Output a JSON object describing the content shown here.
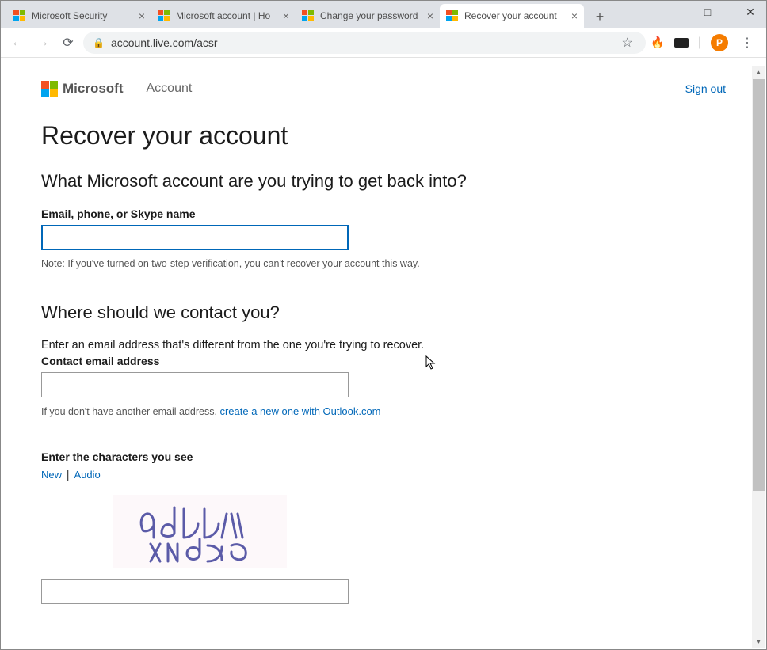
{
  "window_controls": {
    "min": "—",
    "max": "□",
    "close": "✕"
  },
  "tabs": [
    {
      "title": "Microsoft Security"
    },
    {
      "title": "Microsoft account | Ho"
    },
    {
      "title": "Change your password"
    },
    {
      "title": "Recover your account"
    }
  ],
  "address": "account.live.com/acsr",
  "avatar_letter": "P",
  "header": {
    "brand": "Microsoft",
    "section": "Account",
    "signout": "Sign out"
  },
  "page": {
    "h1": "Recover your account",
    "q1": "What Microsoft account are you trying to get back into?",
    "label1": "Email, phone, or Skype name",
    "hint1": "Note: If you've turned on two-step verification, you can't recover your account this way.",
    "q2": "Where should we contact you?",
    "instr2": "Enter an email address that's different from the one you're trying to recover.",
    "label2": "Contact email address",
    "hint2a": "If you don't have another email address, ",
    "hint2b": "create a new one with Outlook.com",
    "captcha_label": "Enter the characters you see",
    "captcha_new": "New",
    "captcha_audio": "Audio",
    "captcha_sep": "|"
  }
}
